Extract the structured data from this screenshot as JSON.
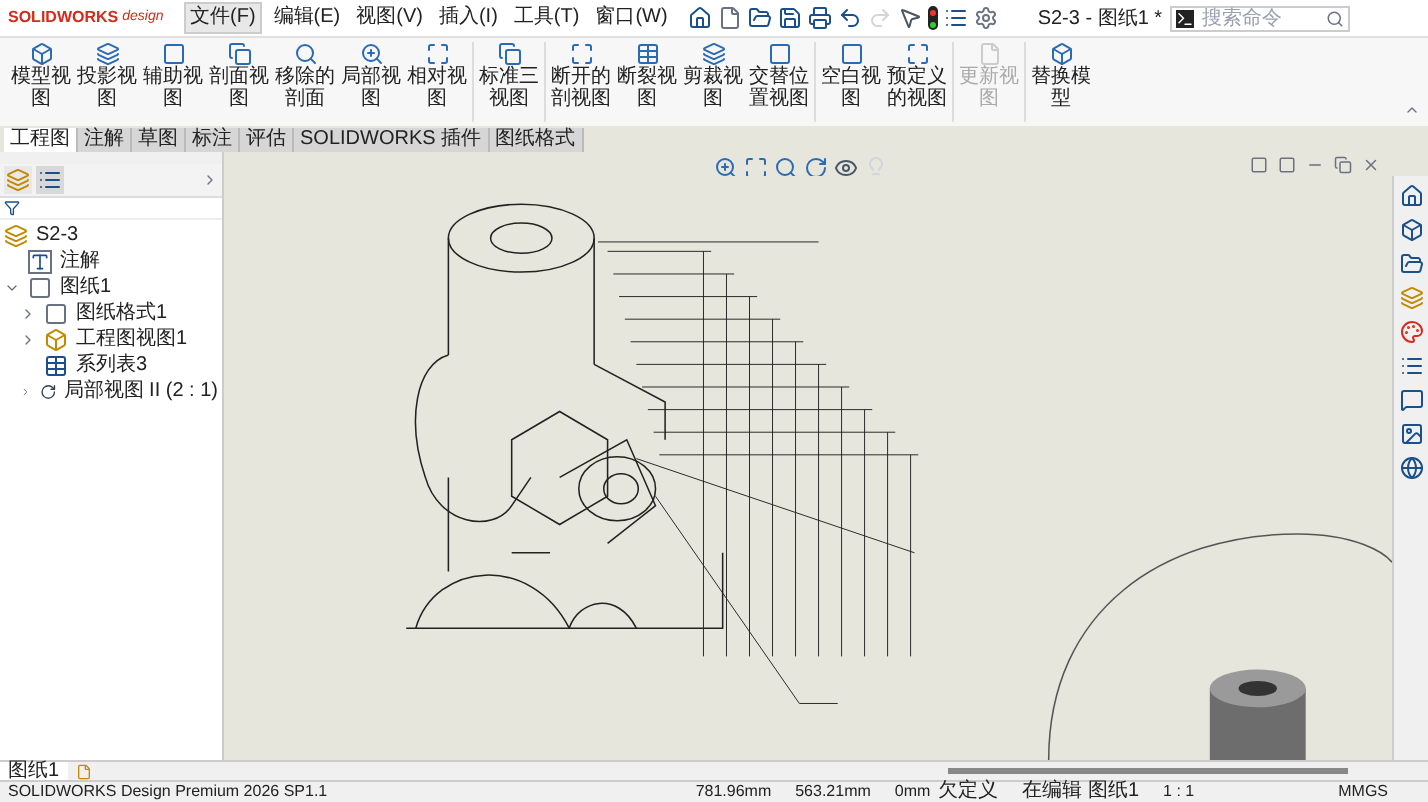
{
  "app": {
    "brand": "SOLIDWORKS",
    "brand_suffix": "design"
  },
  "menu": [
    {
      "label": "文件(F)",
      "selected": true
    },
    {
      "label": "编辑(E)",
      "selected": false
    },
    {
      "label": "视图(V)",
      "selected": false
    },
    {
      "label": "插入(I)",
      "selected": false
    },
    {
      "label": "工具(T)",
      "selected": false
    },
    {
      "label": "窗口(W)",
      "selected": false
    }
  ],
  "window": {
    "title": "S2-3 - 图纸1 *"
  },
  "search": {
    "placeholder": "搜索命令"
  },
  "ribbon_groups": [
    [
      {
        "label": "模型视图",
        "disabled": false
      },
      {
        "label": "投影视图",
        "disabled": false
      },
      {
        "label": "辅助视图",
        "disabled": false
      },
      {
        "label": "剖面视图",
        "disabled": false
      },
      {
        "label": "移除的剖面",
        "disabled": false
      },
      {
        "label": "局部视图",
        "disabled": false
      },
      {
        "label": "相对视图",
        "disabled": false
      }
    ],
    [
      {
        "label": "标准三视图",
        "disabled": false
      }
    ],
    [
      {
        "label": "断开的剖视图",
        "disabled": false
      },
      {
        "label": "断裂视图",
        "disabled": false
      },
      {
        "label": "剪裁视图",
        "disabled": false
      },
      {
        "label": "交替位置视图",
        "disabled": false
      }
    ],
    [
      {
        "label": "空白视图",
        "disabled": false
      },
      {
        "label": "预定义的视图",
        "disabled": false
      }
    ],
    [
      {
        "label": "更新视图",
        "disabled": true
      }
    ],
    [
      {
        "label": "替换模型",
        "disabled": false
      }
    ]
  ],
  "tabs": [
    {
      "label": "工程图",
      "selected": true
    },
    {
      "label": "注解",
      "selected": false
    },
    {
      "label": "草图",
      "selected": false
    },
    {
      "label": "标注",
      "selected": false
    },
    {
      "label": "评估",
      "selected": false
    },
    {
      "label": "SOLIDWORKS 插件",
      "selected": false
    },
    {
      "label": "图纸格式",
      "selected": false
    }
  ],
  "tree": {
    "root": "S2-3",
    "items": [
      {
        "label": "注解",
        "kind": "annotation"
      },
      {
        "label": "图纸1",
        "kind": "sheet",
        "expanded": true,
        "children": [
          {
            "label": "图纸格式1",
            "kind": "format",
            "expanded": false
          },
          {
            "label": "工程图视图1",
            "kind": "view",
            "expanded": false
          },
          {
            "label": "系列表3",
            "kind": "table"
          },
          {
            "label": "局部视图 II (2 : 1)",
            "kind": "detail",
            "expanded": false
          }
        ]
      }
    ]
  },
  "sheet_tabs": [
    {
      "label": "图纸1",
      "selected": true
    }
  ],
  "status_bar": {
    "product": "SOLIDWORKS Design Premium 2026 SP1.1",
    "x": "781.96mm",
    "y": "563.21mm",
    "z": "0mm",
    "state": "欠定义",
    "editing": "在编辑 图纸1",
    "scale": "1 : 1",
    "units": "MMGS"
  }
}
